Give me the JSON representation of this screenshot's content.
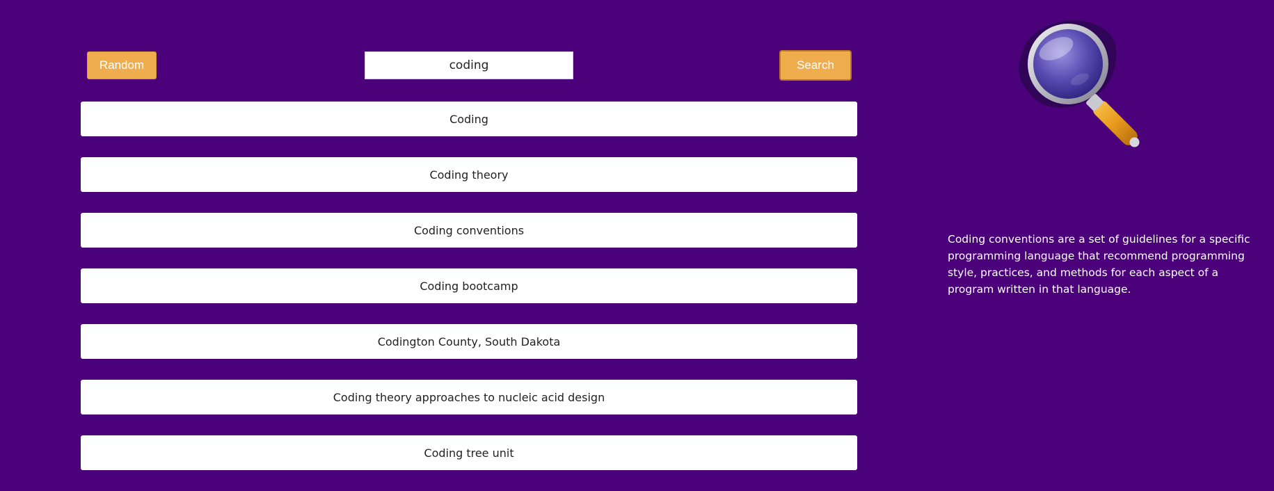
{
  "toolbar": {
    "random_label": "Random",
    "search_label": "Search",
    "search_value": "coding"
  },
  "results": [
    "Coding",
    "Coding theory",
    "Coding conventions",
    "Coding bootcamp",
    "Codington County, South Dakota",
    "Coding theory approaches to nucleic acid design",
    "Coding tree unit"
  ],
  "description": "Coding conventions are a set of guidelines for a specific programming language that recommend programming style, practices, and methods for each aspect of a program written in that language.",
  "colors": {
    "background": "#4a017a",
    "button": "#f0ad4e",
    "result_bg": "#ffffff"
  },
  "icons": {
    "logo": "magnifying-glass-icon"
  }
}
